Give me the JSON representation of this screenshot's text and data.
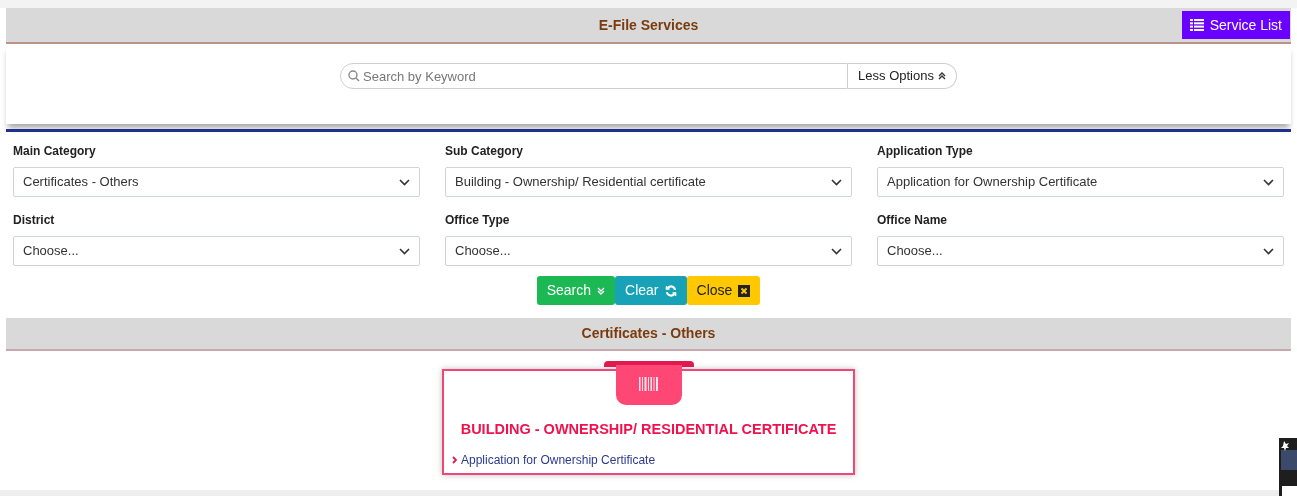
{
  "header": {
    "title": "E-File Services",
    "service_list_button": "Service List"
  },
  "search": {
    "placeholder": "Search by Keyword",
    "options_button": "Less Options"
  },
  "filters": [
    {
      "label": "Main Category",
      "value": "Certificates - Others"
    },
    {
      "label": "Sub Category",
      "value": "Building - Ownership/ Residential certificate"
    },
    {
      "label": "Application Type",
      "value": "Application for Ownership Certificate"
    },
    {
      "label": "District",
      "value": "Choose..."
    },
    {
      "label": "Office Type",
      "value": "Choose..."
    },
    {
      "label": "Office Name",
      "value": "Choose..."
    }
  ],
  "actions": [
    {
      "kind": "search",
      "label": "Search"
    },
    {
      "kind": "clear",
      "label": "Clear"
    },
    {
      "kind": "close",
      "label": "Close"
    }
  ],
  "section": {
    "title": "Certificates - Others"
  },
  "cards": [
    {
      "title": "BUILDING - OWNERSHIP/ RESIDENTIAL CERTIFICATE",
      "links": [
        "Application for Ownership Certificate"
      ]
    }
  ]
}
